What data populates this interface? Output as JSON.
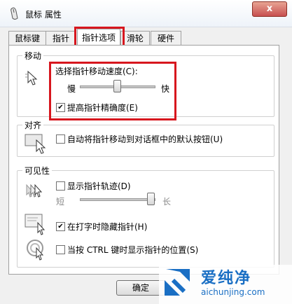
{
  "window": {
    "title": "鼠标 属性",
    "close_glyph": "x"
  },
  "tabs": [
    {
      "label": "鼠标键"
    },
    {
      "label": "指针"
    },
    {
      "label": "指针选项"
    },
    {
      "label": "滑轮"
    },
    {
      "label": "硬件"
    }
  ],
  "motion": {
    "group_title": "移动",
    "speed_label": "选择指针移动速度(C):",
    "slow": "慢",
    "fast": "快",
    "speed_value": 0.5,
    "precision_label": "提高指针精确度(E)",
    "precision_checked": true
  },
  "snap": {
    "group_title": "对齐",
    "snap_label": "自动将指针移动到对话框中的默认按钮(U)",
    "snap_checked": false
  },
  "visibility": {
    "group_title": "可见性",
    "trails_label": "显示指针轨迹(D)",
    "trails_checked": false,
    "short": "短",
    "long": "长",
    "trails_value": 1.0,
    "hide_label": "在打字时隐藏指针(H)",
    "hide_checked": true,
    "ctrl_label": "当按 CTRL 键时显示指针的位置(S)",
    "ctrl_checked": false
  },
  "buttons": {
    "ok": "确定"
  },
  "watermark": {
    "brand": "爱纯净",
    "site": "aichunjing.com"
  },
  "colors": {
    "highlight": "#d7161e",
    "brand": "#1a6fc4"
  }
}
